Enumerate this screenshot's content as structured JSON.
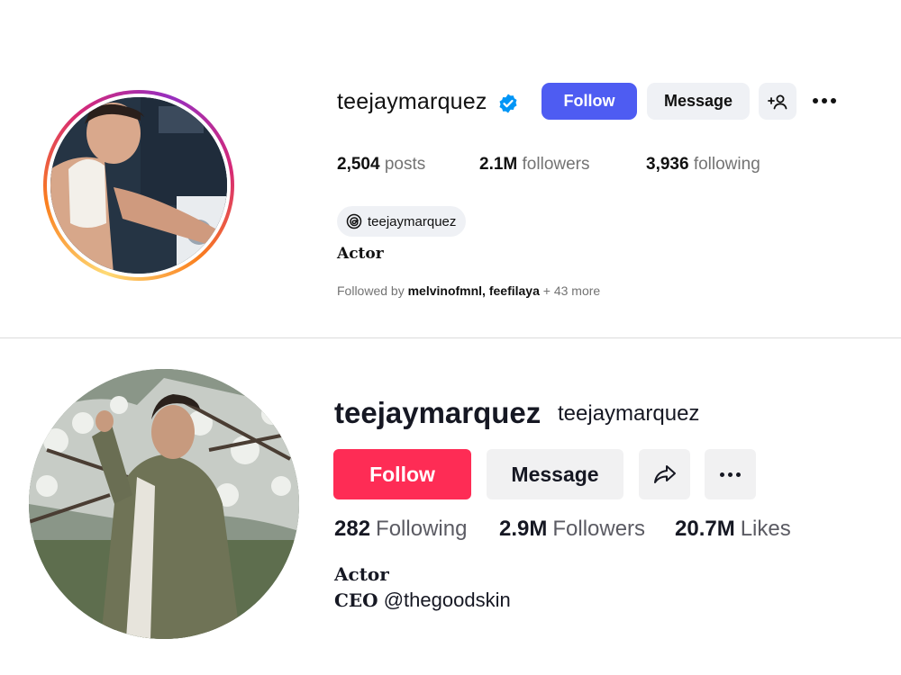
{
  "instagram": {
    "username": "teejaymarquez",
    "follow_label": "Follow",
    "message_label": "Message",
    "stats": [
      {
        "value": "2,504",
        "label": "posts"
      },
      {
        "value": "2.1M",
        "label": "followers"
      },
      {
        "value": "3,936",
        "label": "following"
      }
    ],
    "threads_handle": "teejaymarquez",
    "bio": "Actor",
    "followed_by": {
      "prefix": "Followed by",
      "names": "melvinofmnl, feefilaya",
      "suffix": "+ 43 more"
    },
    "colors": {
      "follow": "#4e5cf2",
      "verified": "#0095f6"
    }
  },
  "tiktok": {
    "username": "teejaymarquez",
    "nickname": "teejaymarquez",
    "follow_label": "Follow",
    "message_label": "Message",
    "stats": [
      {
        "value": "282",
        "label": "Following"
      },
      {
        "value": "2.9M",
        "label": "Followers"
      },
      {
        "value": "20.7M",
        "label": "Likes"
      }
    ],
    "bio_line1": "Actor",
    "bio_line2_prefix": "CEO",
    "bio_line2_handle": "@thegoodskin",
    "colors": {
      "follow": "#fe2c55"
    }
  },
  "icons": [
    "verified-badge-icon",
    "add-user-icon",
    "more-options-icon",
    "threads-icon",
    "share-icon"
  ]
}
